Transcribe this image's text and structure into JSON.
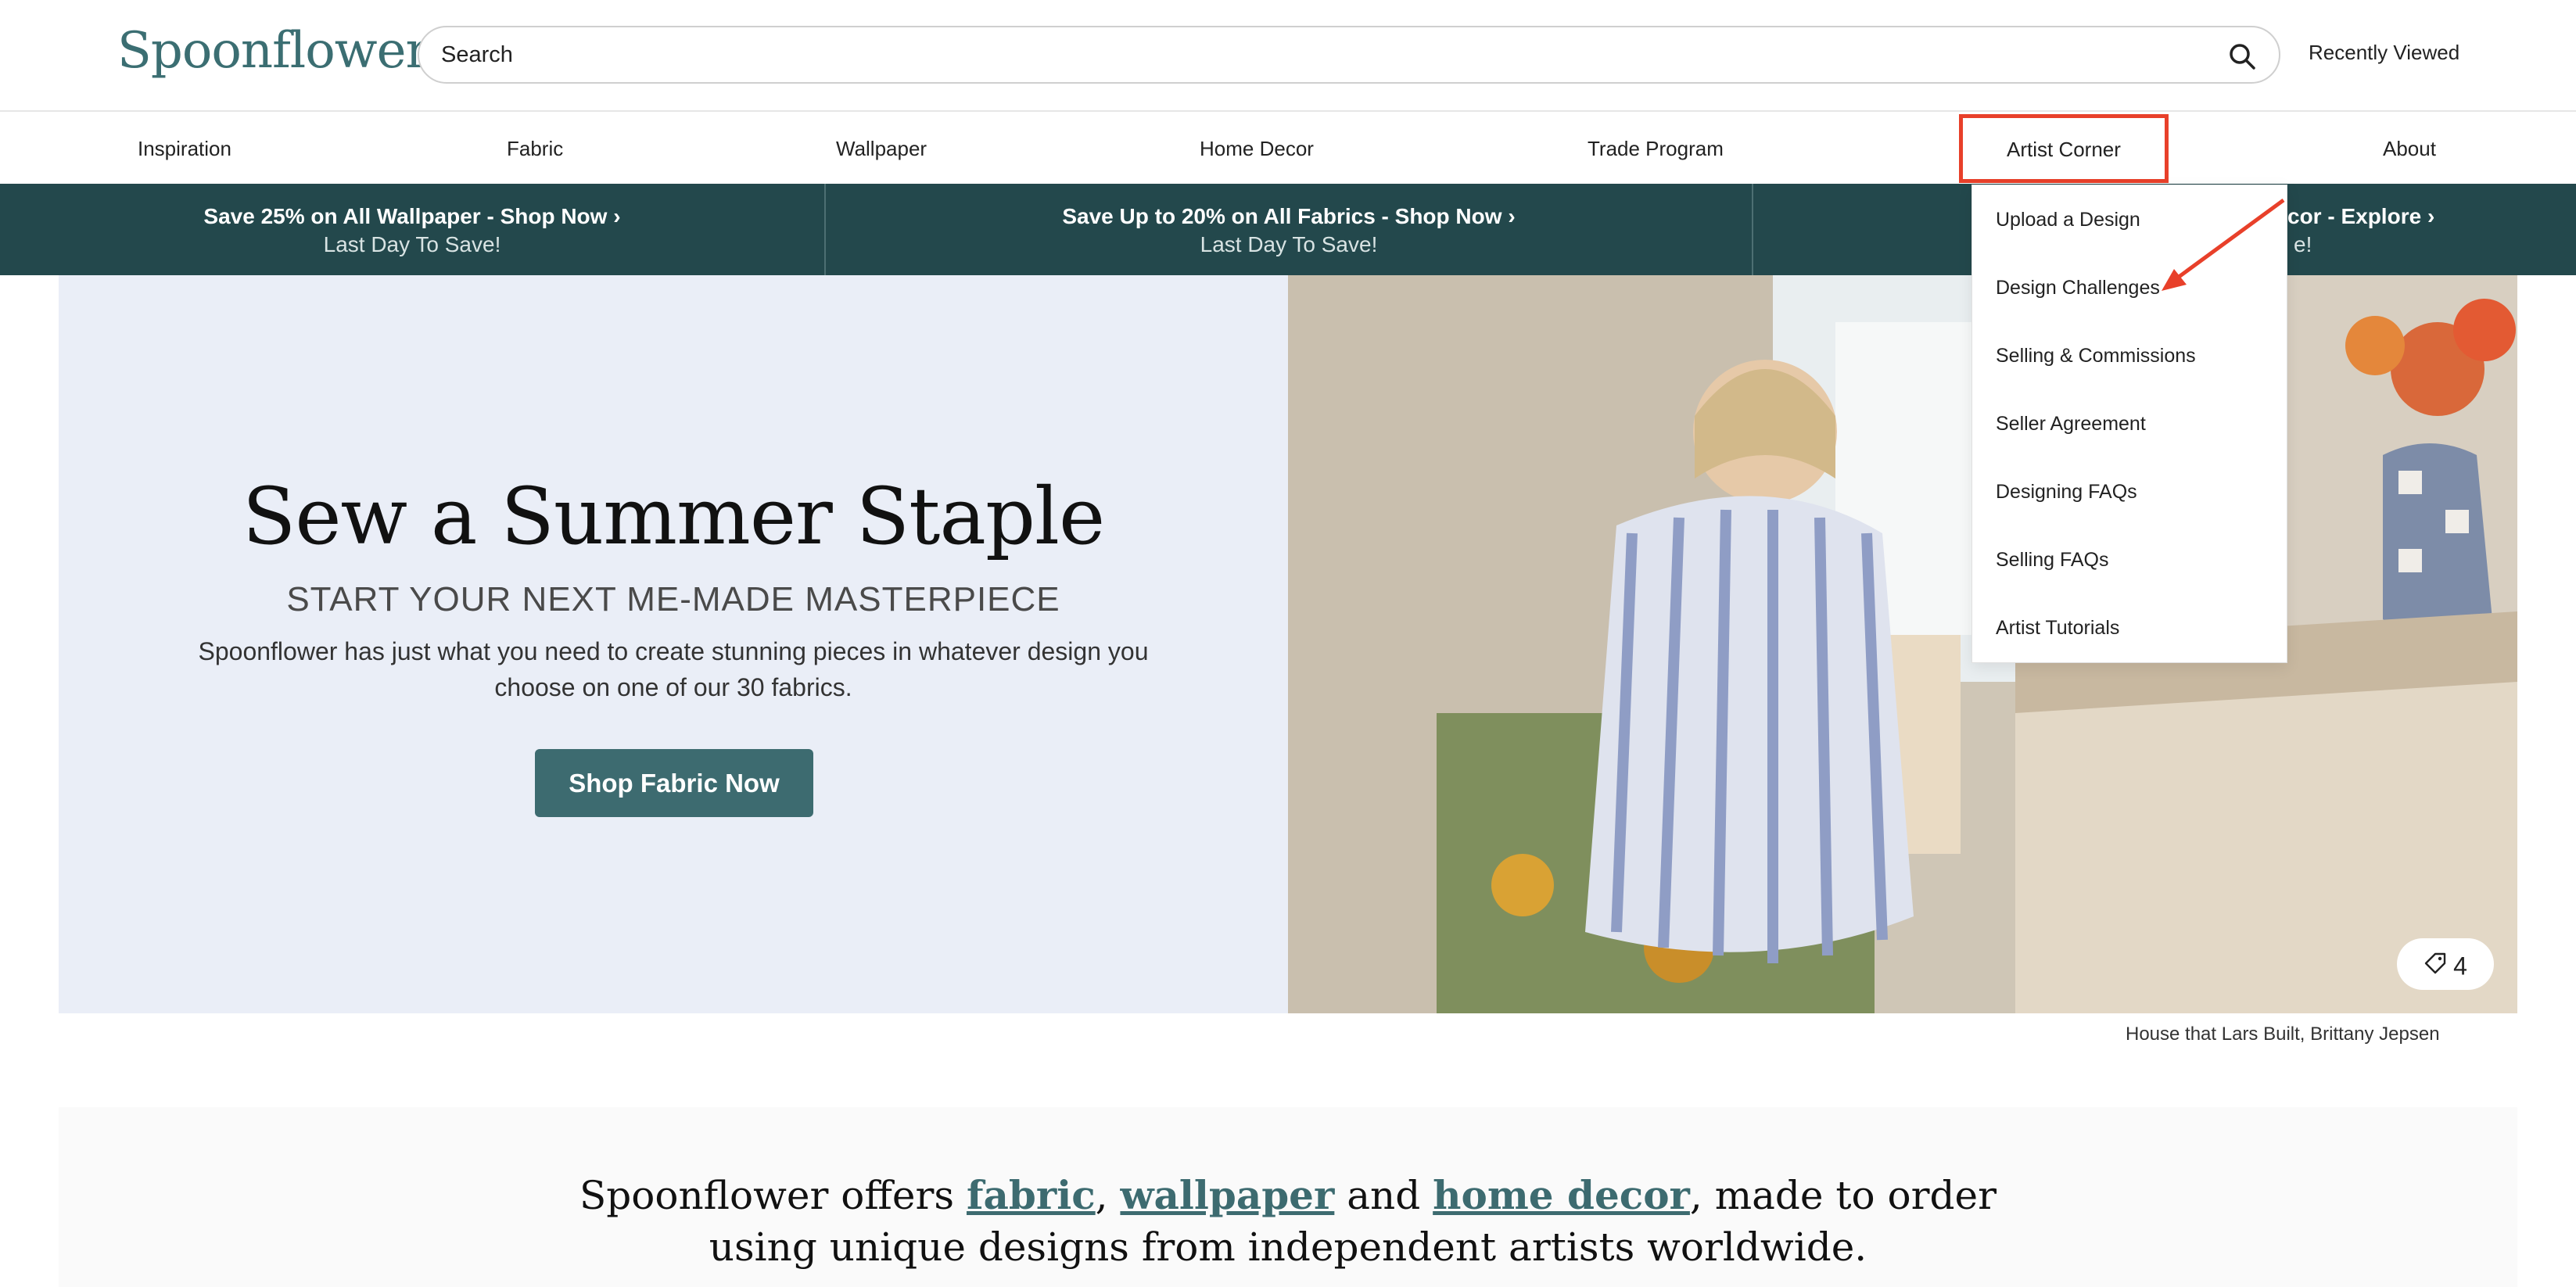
{
  "header": {
    "logo": "Spoonflower",
    "search_placeholder": "Search",
    "recently_viewed": "Recently Viewed"
  },
  "nav": {
    "items": [
      "Inspiration",
      "Fabric",
      "Wallpaper",
      "Home Decor",
      "Trade Program",
      "Artist Corner",
      "About"
    ],
    "active": "Artist Corner"
  },
  "promo": [
    {
      "line1": "Save 25% on All Wallpaper - Shop Now",
      "line2": "Last Day To Save!"
    },
    {
      "line1": "Save Up to 20% on All Fabrics - Shop Now",
      "line2": "Last Day To Save!"
    },
    {
      "line1": "cor - Explore",
      "line2": "e!"
    }
  ],
  "hero": {
    "title": "Sew a Summer Staple",
    "subtitle": "START YOUR NEXT ME-MADE MASTERPIECE",
    "description": "Spoonflower has just what you need to create stunning pieces in whatever design you choose on one of our 30 fabrics.",
    "button": "Shop Fabric Now",
    "tag_count": "4",
    "credit": "House that Lars Built, Brittany Jepsen"
  },
  "dropdown": {
    "items": [
      "Upload a Design",
      "Design Challenges",
      "Selling & Commissions",
      "Seller Agreement",
      "Designing FAQs",
      "Selling FAQs",
      "Artist Tutorials"
    ]
  },
  "tagline": {
    "part1": "Spoonflower offers ",
    "fabric": "fabric",
    "comma": ", ",
    "wallpaper": "wallpaper",
    "and": " and ",
    "home_decor": "home decor",
    "part2": ", made to order",
    "line2": "using unique designs from independent artists worldwide."
  },
  "colors": {
    "brand": "#3b6e72",
    "promo_bg": "#23484c",
    "highlight": "#e8402a",
    "hero_bg": "#eaeef7"
  }
}
